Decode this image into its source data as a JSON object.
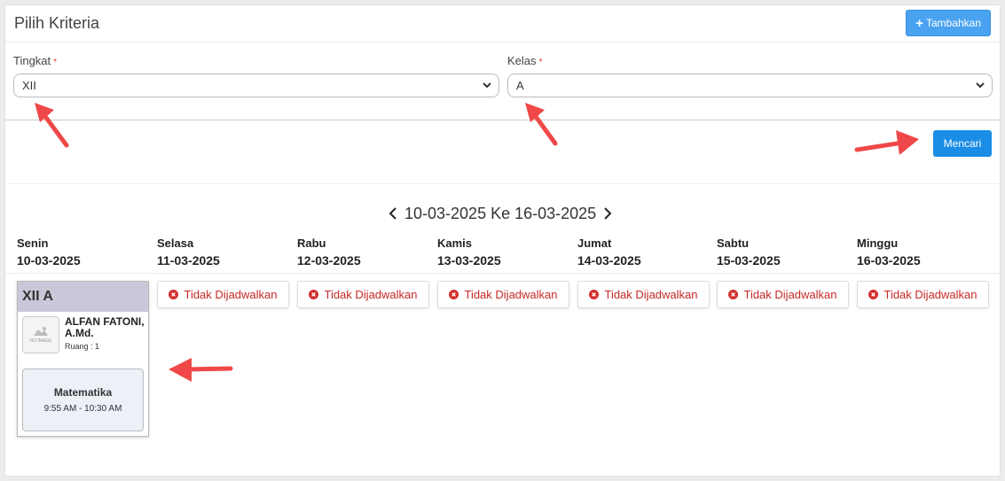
{
  "header": {
    "title": "Pilih Kriteria",
    "add_label": "Tambahkan"
  },
  "filters": {
    "tingkat": {
      "label": "Tingkat",
      "required_mark": "*",
      "value": "XII"
    },
    "kelas": {
      "label": "Kelas",
      "required_mark": "*",
      "value": "A"
    }
  },
  "search_label": "Mencari",
  "range": "10-03-2025 Ke 16-03-2025",
  "days": [
    {
      "name": "Senin",
      "date": "10-03-2025"
    },
    {
      "name": "Selasa",
      "date": "11-03-2025"
    },
    {
      "name": "Rabu",
      "date": "12-03-2025"
    },
    {
      "name": "Kamis",
      "date": "13-03-2025"
    },
    {
      "name": "Jumat",
      "date": "14-03-2025"
    },
    {
      "name": "Sabtu",
      "date": "15-03-2025"
    },
    {
      "name": "Minggu",
      "date": "16-03-2025"
    }
  ],
  "not_scheduled": "Tidak Dijadwalkan",
  "schedule": {
    "class": "XII A",
    "avatar_text": "NO IMAGE",
    "teacher": "ALFAN FATONI, A.Md.",
    "room": "Ruang : 1",
    "subject": "Matematika",
    "time": "9:55 AM - 10:30 AM"
  },
  "colors": {
    "accent": "#1a8de6",
    "add_button": "#4aa3f0",
    "not_scheduled": "#c62828",
    "annotation_arrow": "#f04848",
    "class_header": "#c8c8d9"
  }
}
